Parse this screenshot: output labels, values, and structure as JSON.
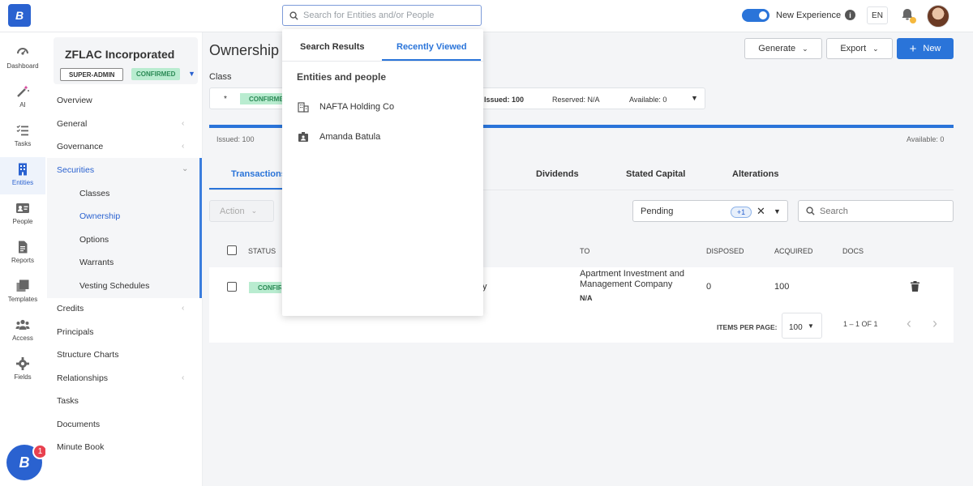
{
  "topbar": {
    "logo_letter": "B",
    "search_placeholder": "Search for Entities and/or People",
    "new_experience_label": "New Experience",
    "info_glyph": "i",
    "language": "EN"
  },
  "rail": {
    "items": [
      {
        "label": "Dashboard",
        "icon": "dashboard-icon"
      },
      {
        "label": "AI",
        "icon": "magic-wand-icon"
      },
      {
        "label": "Tasks",
        "icon": "tasks-icon"
      },
      {
        "label": "Entities",
        "icon": "building-icon"
      },
      {
        "label": "People",
        "icon": "person-card-icon"
      },
      {
        "label": "Reports",
        "icon": "report-icon"
      },
      {
        "label": "Templates",
        "icon": "templates-icon"
      },
      {
        "label": "Access",
        "icon": "group-icon"
      },
      {
        "label": "Fields",
        "icon": "gear-icon"
      }
    ],
    "chat_letter": "B",
    "chat_badge": "1"
  },
  "company": {
    "name": "ZFLAC Incorporated",
    "role_badge": "SUPER-ADMIN",
    "status_badge": "CONFIRMED"
  },
  "nav": {
    "overview": "Overview",
    "general": "General",
    "governance": "Governance",
    "securities": "Securities",
    "classes": "Classes",
    "ownership": "Ownership",
    "options": "Options",
    "warrants": "Warrants",
    "vesting": "Vesting Schedules",
    "credits": "Credits",
    "principals": "Principals",
    "structure_charts": "Structure Charts",
    "relationships": "Relationships",
    "tasks": "Tasks",
    "documents": "Documents",
    "minute_book": "Minute Book"
  },
  "main": {
    "title": "Ownership",
    "generate_label": "Generate",
    "export_label": "Export",
    "new_label": "New",
    "class_label": "Class",
    "class_select": {
      "star": "*",
      "status": "CONFIRMED",
      "issued": "Issued: 100",
      "reserved": "Reserved: N/A",
      "available": "Available: 0"
    },
    "progress": {
      "issued": "Issued: 100",
      "available": "Available: 0",
      "fill_fraction": 1.0
    },
    "tabs": [
      "Transactions",
      "Dividends",
      "Stated Capital",
      "Alterations"
    ],
    "action_label": "Action",
    "filter_value": "Pending",
    "filter_extra": "+1",
    "search_placeholder": "Search"
  },
  "table": {
    "headers": {
      "status": "STATUS",
      "to": "TO",
      "disposed": "DISPOSED",
      "acquired": "ACQUIRED",
      "docs": "DOCS"
    },
    "rows": [
      {
        "status": "CONFIRMED",
        "from_tail": "y",
        "to_line1": "Apartment Investment and",
        "to_line2": "Management Company",
        "to_sub": "N/A",
        "disposed": "0",
        "acquired": "100"
      }
    ],
    "items_per_page_label": "ITEMS PER PAGE:",
    "items_per_page": "100",
    "range": "1 – 1 OF 1"
  },
  "dropdown": {
    "tabs": [
      "Search Results",
      "Recently Viewed"
    ],
    "heading": "Entities and people",
    "items": [
      {
        "label": "NAFTA Holding Co",
        "icon": "building-icon"
      },
      {
        "label": "Amanda Batula",
        "icon": "person-badge-icon"
      }
    ]
  },
  "colors": {
    "accent": "#2a74d9",
    "brand": "#2a62d0",
    "confirmed_bg": "#b9ecd0",
    "confirmed_text": "#2a8a55",
    "badge_red": "#e8414f"
  }
}
